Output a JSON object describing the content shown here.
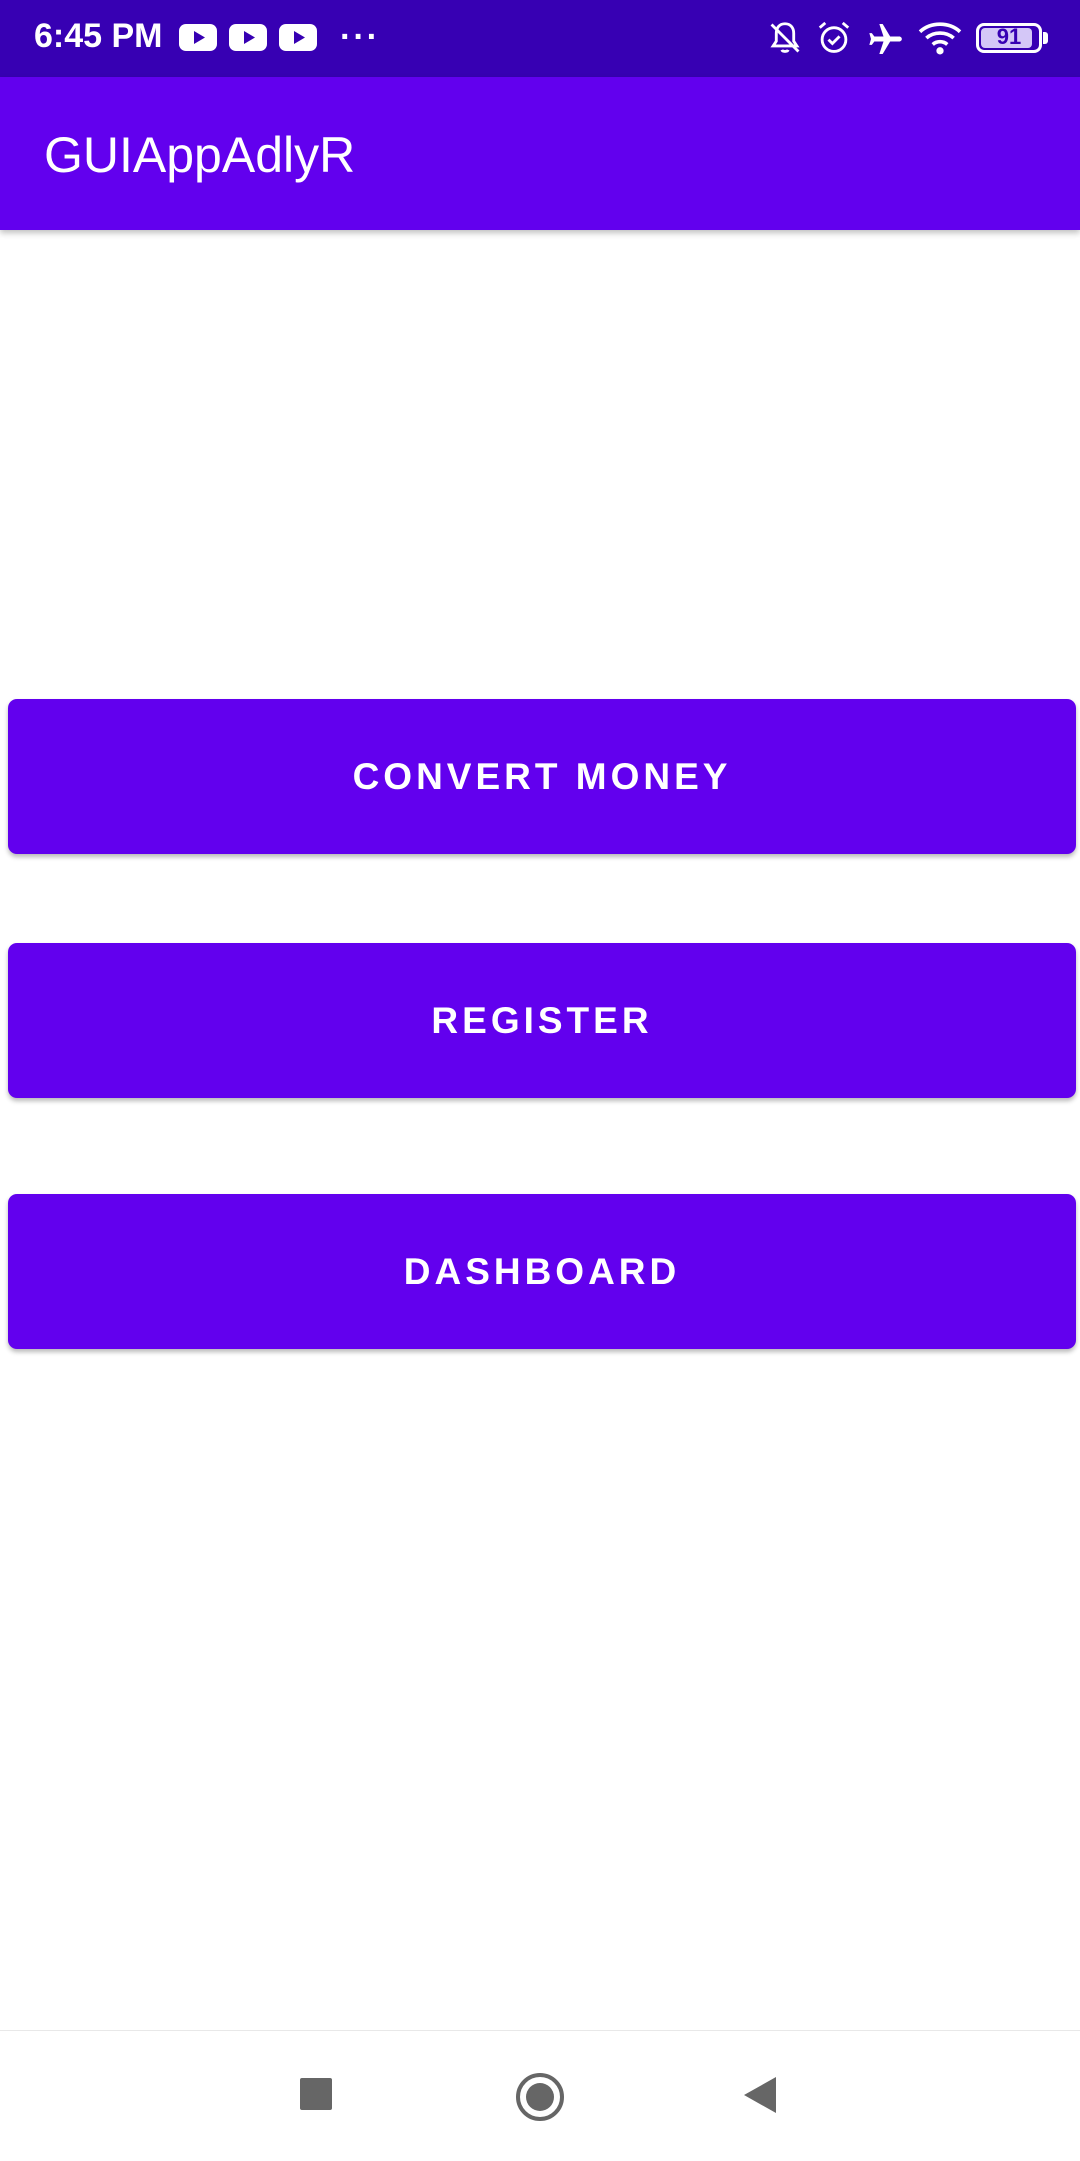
{
  "status_bar": {
    "time": "6:45 PM",
    "notification_icons": [
      "youtube-icon",
      "youtube-icon",
      "youtube-icon"
    ],
    "more_label": "···",
    "system_icons": [
      "bell-off-icon",
      "alarm-icon",
      "airplane-icon",
      "wifi-icon",
      "battery-icon"
    ],
    "battery_level": "91"
  },
  "app_bar": {
    "title": "GUIAppAdlyR"
  },
  "main": {
    "buttons": [
      {
        "label": "CONVERT MONEY"
      },
      {
        "label": "REGISTER"
      },
      {
        "label": "DASHBOARD"
      }
    ]
  },
  "nav_bar": {
    "icons": [
      "recents-icon",
      "home-icon",
      "back-icon"
    ]
  },
  "colors": {
    "status_bar": "#3700B3",
    "primary": "#6200EE",
    "on_primary": "#FFFFFF",
    "nav_icon": "#666666"
  }
}
